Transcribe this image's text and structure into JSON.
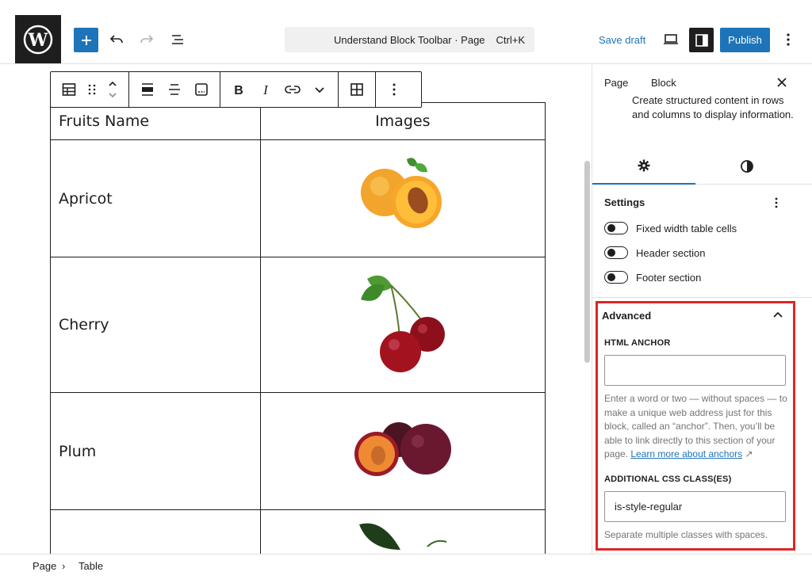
{
  "header": {
    "doc_title": "Understand Block Toolbar · Page",
    "shortcut": "Ctrl+K",
    "save_draft": "Save draft",
    "publish": "Publish"
  },
  "table": {
    "headers": [
      "Fruits Name",
      "Images"
    ],
    "rows": [
      {
        "name": "Apricot",
        "image": "apricot-image"
      },
      {
        "name": "Cherry",
        "image": "cherry-image"
      },
      {
        "name": "Plum",
        "image": "plum-image"
      },
      {
        "name": "",
        "image": "leaf-image"
      }
    ]
  },
  "sidebar": {
    "tabs": [
      "Page",
      "Block"
    ],
    "description": "Create structured content in rows and columns to display information.",
    "settings_title": "Settings",
    "toggles": [
      "Fixed width table cells",
      "Header section",
      "Footer section"
    ],
    "advanced_title": "Advanced",
    "html_anchor_label": "HTML ANCHOR",
    "html_anchor_value": "",
    "anchor_help": "Enter a word or two — without spaces — to make a unique web address just for this block, called an “anchor”. Then, you’ll be able to link directly to this section of your page.",
    "anchor_link": "Learn more about anchors",
    "css_label": "ADDITIONAL CSS CLASS(ES)",
    "css_value": "is-style-regular",
    "css_help": "Separate multiple classes with spaces."
  },
  "breadcrumb": [
    "Page",
    "Table"
  ],
  "colors": {
    "accent": "#1d74b8",
    "highlight": "#dc2626",
    "dark": "#1e1e1e"
  }
}
